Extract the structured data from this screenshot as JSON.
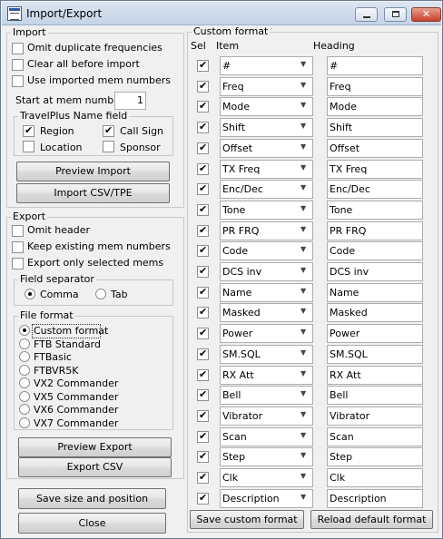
{
  "window": {
    "title": "Import/Export"
  },
  "import": {
    "legend": "Import",
    "omit_duplicates": {
      "label": "Omit duplicate frequencies",
      "checked": false
    },
    "clear_all": {
      "label": "Clear all before import",
      "checked": false
    },
    "use_imported_mem": {
      "label": "Use imported mem numbers",
      "checked": false
    },
    "start_label": "Start at mem number",
    "start_value": "1",
    "travelplus": {
      "legend": "TravelPlus Name field",
      "region": {
        "label": "Region",
        "checked": true
      },
      "call_sign": {
        "label": "Call Sign",
        "checked": true
      },
      "location": {
        "label": "Location",
        "checked": false
      },
      "sponsor": {
        "label": "Sponsor",
        "checked": false
      }
    },
    "preview_button": "Preview Import",
    "import_button": "Import CSV/TPE"
  },
  "export": {
    "legend": "Export",
    "omit_header": {
      "label": "Omit header",
      "checked": false
    },
    "keep_existing": {
      "label": "Keep existing mem numbers",
      "checked": false
    },
    "export_selected": {
      "label": "Export only selected mems",
      "checked": false
    },
    "separator": {
      "legend": "Field separator",
      "comma": "Comma",
      "tab": "Tab",
      "selected": "comma"
    },
    "file_format": {
      "legend": "File format",
      "options": [
        "Custom format",
        "FTB Standard",
        "FTBasic",
        "FTBVR5K",
        "VX2 Commander",
        "VX5 Commander",
        "VX6 Commander",
        "VX7 Commander"
      ],
      "selected": "Custom format"
    },
    "preview_button": "Preview Export",
    "export_button": "Export CSV"
  },
  "save_size_button": "Save size and position",
  "close_button": "Close",
  "custom": {
    "legend": "Custom format",
    "col_sel": "Sel",
    "col_item": "Item",
    "col_heading": "Heading",
    "rows": [
      {
        "item": "#",
        "heading": "#",
        "sel": true
      },
      {
        "item": "Freq",
        "heading": "Freq",
        "sel": true
      },
      {
        "item": "Mode",
        "heading": "Mode",
        "sel": true
      },
      {
        "item": "Shift",
        "heading": "Shift",
        "sel": true
      },
      {
        "item": "Offset",
        "heading": "Offset",
        "sel": true
      },
      {
        "item": "TX Freq",
        "heading": "TX Freq",
        "sel": true
      },
      {
        "item": "Enc/Dec",
        "heading": "Enc/Dec",
        "sel": true
      },
      {
        "item": "Tone",
        "heading": "Tone",
        "sel": true
      },
      {
        "item": "PR FRQ",
        "heading": "PR FRQ",
        "sel": true
      },
      {
        "item": "Code",
        "heading": "Code",
        "sel": true
      },
      {
        "item": "DCS inv",
        "heading": "DCS inv",
        "sel": true
      },
      {
        "item": "Name",
        "heading": "Name",
        "sel": true
      },
      {
        "item": "Masked",
        "heading": "Masked",
        "sel": true
      },
      {
        "item": "Power",
        "heading": "Power",
        "sel": true
      },
      {
        "item": "SM.SQL",
        "heading": "SM.SQL",
        "sel": true
      },
      {
        "item": "RX Att",
        "heading": "RX Att",
        "sel": true
      },
      {
        "item": "Bell",
        "heading": "Bell",
        "sel": true
      },
      {
        "item": "Vibrator",
        "heading": "Vibrator",
        "sel": true
      },
      {
        "item": "Scan",
        "heading": "Scan",
        "sel": true
      },
      {
        "item": "Step",
        "heading": "Step",
        "sel": true
      },
      {
        "item": "Clk",
        "heading": "Clk",
        "sel": true
      },
      {
        "item": "Description",
        "heading": "Description",
        "sel": true
      }
    ],
    "save_button": "Save custom format",
    "reload_button": "Reload default format"
  }
}
